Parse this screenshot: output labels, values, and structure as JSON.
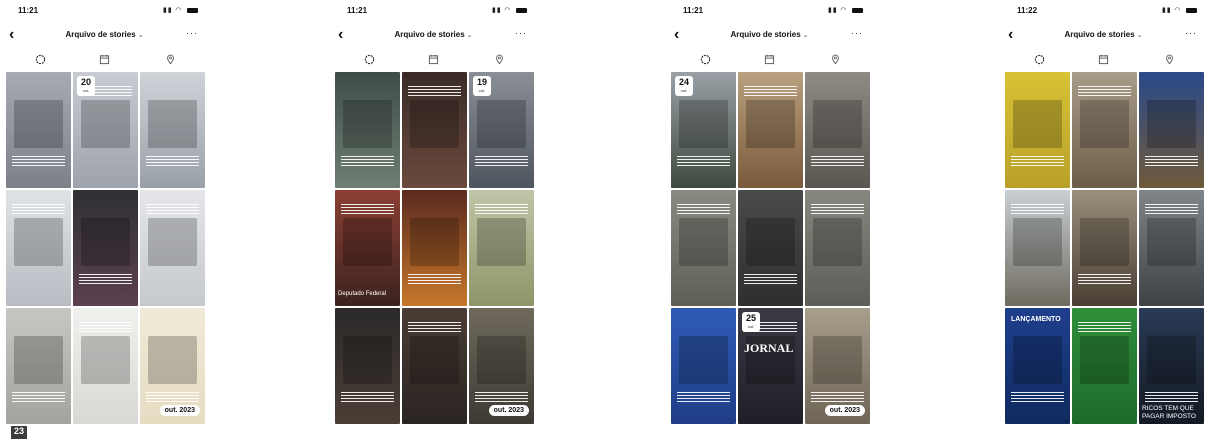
{
  "screens": [
    {
      "time": "11:21",
      "title": "Arquivo de stories",
      "tiles": [
        {
          "bg": "linear-gradient(#a6aab2,#7d8088)",
          "badge_day": "",
          "badge_month": "",
          "text": "",
          "year": ""
        },
        {
          "bg": "linear-gradient(#c8cbd2,#9ea2ab)",
          "badge_day": "20",
          "badge_month": "out.",
          "text": "",
          "year": ""
        },
        {
          "bg": "linear-gradient(#d0d3d8,#9aa0a8)",
          "badge_day": "",
          "badge_month": "",
          "text": "",
          "year": ""
        },
        {
          "bg": "linear-gradient(#dfe2e6,#b8bcc2)",
          "badge_day": "",
          "badge_month": "",
          "text": "",
          "year": ""
        },
        {
          "bg": "linear-gradient(#2f3036,#5c4150)",
          "badge_day": "",
          "badge_month": "",
          "text": "",
          "year": ""
        },
        {
          "bg": "linear-gradient(#e4e6e9,#c5c8cc)",
          "badge_day": "",
          "badge_month": "",
          "text": "",
          "year": ""
        },
        {
          "bg": "linear-gradient(#c6c6c3,#a4a39e)",
          "badge_day": "",
          "badge_month": "",
          "text": "",
          "year": ""
        },
        {
          "bg": "linear-gradient(#f0f0ee,#d8d8d4)",
          "badge_day": "",
          "badge_month": "",
          "text": "",
          "year": ""
        },
        {
          "bg": "linear-gradient(#f1ead8,#e6dcc2)",
          "badge_day": "",
          "badge_month": "",
          "text": "",
          "year": "out. 2023"
        }
      ],
      "bottom_badge": "23"
    },
    {
      "time": "11:21",
      "title": "Arquivo de stories",
      "tiles": [
        {
          "bg": "linear-gradient(#3f4d4a,#6f7e72)",
          "badge_day": "",
          "badge_month": "",
          "text": "",
          "year": ""
        },
        {
          "bg": "linear-gradient(#3a2b28,#6b4a3d)",
          "badge_day": "",
          "badge_month": "",
          "text": "",
          "year": ""
        },
        {
          "bg": "linear-gradient(#8a8f96,#4f555e)",
          "badge_day": "19",
          "badge_month": "out.",
          "text": "",
          "year": ""
        },
        {
          "bg": "linear-gradient(#8c3f33,#3b2320)",
          "badge_day": "",
          "badge_month": "",
          "text": "Deputado Federal",
          "year": ""
        },
        {
          "bg": "linear-gradient(#5a2a20,#c7772a)",
          "badge_day": "",
          "badge_month": "",
          "text": "",
          "year": ""
        },
        {
          "bg": "linear-gradient(#c1c5a8,#8f9468)",
          "badge_day": "",
          "badge_month": "",
          "text": "",
          "year": ""
        },
        {
          "bg": "linear-gradient(#2b2a2a,#4c3e36)",
          "badge_day": "",
          "badge_month": "",
          "text": "",
          "year": ""
        },
        {
          "bg": "linear-gradient(#4a3d35,#2a2421)",
          "badge_day": "",
          "badge_month": "",
          "text": "",
          "year": ""
        },
        {
          "bg": "linear-gradient(#6f6a5c,#3d3a33)",
          "badge_day": "",
          "badge_month": "",
          "text": "",
          "year": "out. 2023"
        }
      ],
      "bottom_badge": ""
    },
    {
      "time": "11:21",
      "title": "Arquivo de stories",
      "tiles": [
        {
          "bg": "linear-gradient(#9aa0a6,#3e4a3f)",
          "badge_day": "24",
          "badge_month": "out.",
          "text": "",
          "year": ""
        },
        {
          "bg": "linear-gradient(#b9a07f,#7a5a3a)",
          "badge_day": "",
          "badge_month": "",
          "text": "",
          "year": ""
        },
        {
          "bg": "linear-gradient(#8e8a84,#5b5650)",
          "badge_day": "",
          "badge_month": "",
          "text": "",
          "year": ""
        },
        {
          "bg": "linear-gradient(#8a8a82,#5e6058)",
          "badge_day": "",
          "badge_month": "",
          "text": "",
          "year": ""
        },
        {
          "bg": "linear-gradient(#4a4a4a,#2f2f2f)",
          "badge_day": "",
          "badge_month": "",
          "text": "",
          "year": ""
        },
        {
          "bg": "linear-gradient(#87867f,#5f5d57)",
          "badge_day": "",
          "badge_month": "",
          "text": "",
          "year": ""
        },
        {
          "bg": "linear-gradient(#2f5bb7,#1f3e86)",
          "badge_day": "",
          "badge_month": "",
          "text": "",
          "year": ""
        },
        {
          "bg": "linear-gradient(#3a3a44,#1f1f28)",
          "badge_day": "25",
          "badge_month": "out.",
          "text": "JORNAL",
          "year": ""
        },
        {
          "bg": "linear-gradient(#a89e8c,#6e6556)",
          "badge_day": "",
          "badge_month": "",
          "text": "",
          "year": "out. 2023"
        }
      ],
      "bottom_badge": ""
    },
    {
      "time": "11:22",
      "title": "Arquivo de stories",
      "tiles": [
        {
          "bg": "linear-gradient(#d8c235,#b9a12a)",
          "badge_day": "",
          "badge_month": "",
          "text": "",
          "year": ""
        },
        {
          "bg": "linear-gradient(#a89d8a,#6d5d47)",
          "badge_day": "",
          "badge_month": "",
          "text": "",
          "year": ""
        },
        {
          "bg": "linear-gradient(#2a4a8a,#6f5a3a)",
          "badge_day": "",
          "badge_month": "",
          "text": "",
          "year": ""
        },
        {
          "bg": "linear-gradient(#c9cfd4,#6e6a60)",
          "badge_day": "",
          "badge_month": "",
          "text": "",
          "year": ""
        },
        {
          "bg": "linear-gradient(#9a8f7c,#4a3f34)",
          "badge_day": "",
          "badge_month": "",
          "text": "",
          "year": ""
        },
        {
          "bg": "linear-gradient(#7f8588,#3d4247)",
          "badge_day": "",
          "badge_month": "",
          "text": "",
          "year": ""
        },
        {
          "bg": "linear-gradient(#1f3f8e,#0e2a5e)",
          "badge_day": "",
          "badge_month": "",
          "text": "LANÇAMENTO",
          "year": ""
        },
        {
          "bg": "linear-gradient(#2f8f3a,#1d6a2a)",
          "badge_day": "",
          "badge_month": "",
          "text": "",
          "year": ""
        },
        {
          "bg": "linear-gradient(#2a3a55,#141a24)",
          "badge_day": "",
          "badge_month": "",
          "text": "RICOS TEM QUE PAGAR IMPOSTO",
          "year": ""
        }
      ],
      "bottom_badge": ""
    }
  ]
}
